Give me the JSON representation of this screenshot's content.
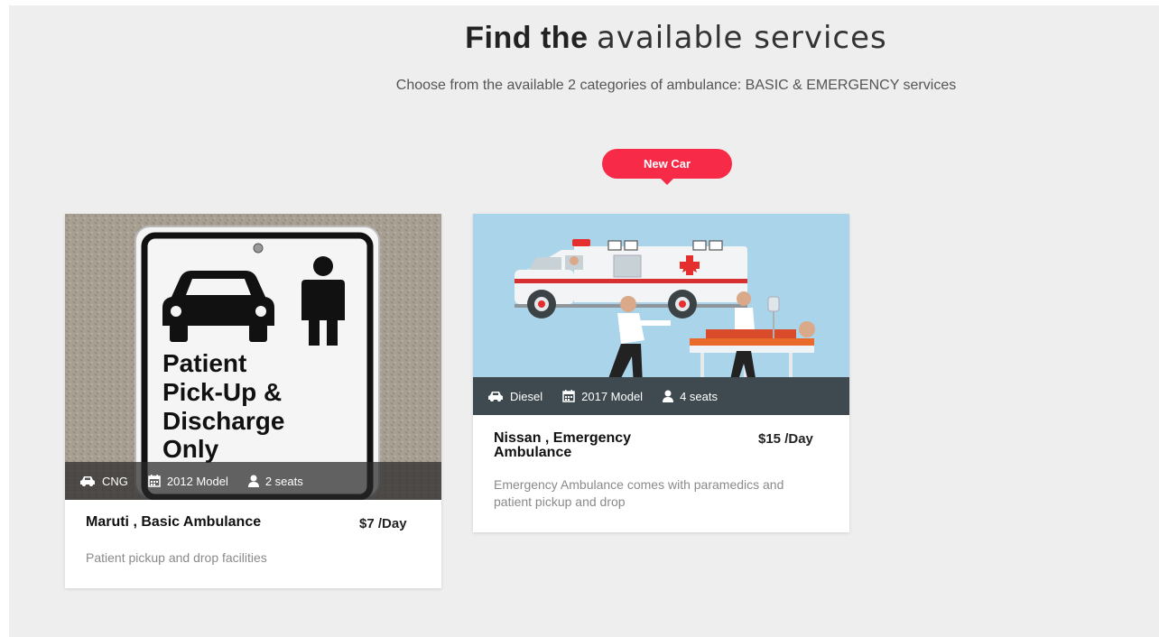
{
  "header": {
    "title_bold": "Find the",
    "title_light": "available services",
    "subtitle": "Choose from the available 2 categories of ambulance: BASIC & EMERGENCY services"
  },
  "badge": {
    "label": "New Car",
    "color": "#f72b47"
  },
  "cards": [
    {
      "title": "Maruti , Basic Ambulance",
      "price": "$7 /Day",
      "description": "Patient pickup and drop facilities",
      "image_sign_lines": [
        "Patient",
        "Pick-Up &",
        "Discharge",
        "Only"
      ],
      "specs": [
        {
          "icon": "car-icon",
          "label": "CNG"
        },
        {
          "icon": "calendar-icon",
          "label": "2012 Model"
        },
        {
          "icon": "user-icon",
          "label": "2 seats"
        }
      ]
    },
    {
      "title": "Nissan , Emergency Ambulance",
      "price": "$15 /Day",
      "description": "Emergency Ambulance comes with paramedics and patient pickup and drop",
      "specs": [
        {
          "icon": "car-icon",
          "label": "Diesel"
        },
        {
          "icon": "calendar-icon",
          "label": "2017 Model"
        },
        {
          "icon": "user-icon",
          "label": "4 seats"
        }
      ]
    }
  ]
}
